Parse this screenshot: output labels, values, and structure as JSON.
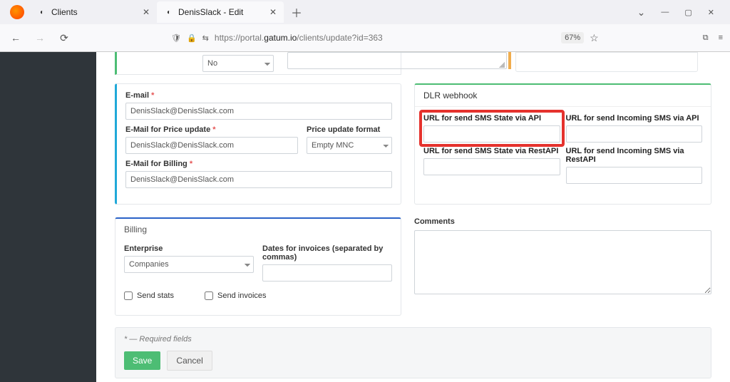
{
  "browser": {
    "tabs": [
      {
        "title": "Clients",
        "favicon": "◐"
      },
      {
        "title": "DenisSlack - Edit",
        "favicon": "◐",
        "active": true
      }
    ],
    "url_prefix": "https://portal.",
    "url_domain": "gatum.io",
    "url_path": "/clients/update?id=363",
    "zoom": "67%"
  },
  "topcard": {
    "select_value": "No"
  },
  "email_block": {
    "email_label": "E-mail",
    "email_value": "DenisSlack@DenisSlack.com",
    "price_label": "E-Mail for Price update",
    "price_value": "DenisSlack@DenisSlack.com",
    "format_label": "Price update format",
    "format_value": "Empty MNC",
    "billing_label": "E-Mail for Billing",
    "billing_value": "DenisSlack@DenisSlack.com"
  },
  "dlr": {
    "title": "DLR webhook",
    "f1": "URL for send SMS State via API",
    "f2": "URL for send Incoming SMS via API",
    "f3": "URL for send SMS State via RestAPI",
    "f4": "URL for send Incoming SMS via RestAPI"
  },
  "billing": {
    "title": "Billing",
    "enterprise_label": "Enterprise",
    "enterprise_value": "Companies",
    "dates_label": "Dates for invoices (separated by commas)",
    "send_stats": "Send stats",
    "send_invoices": "Send invoices"
  },
  "comments": {
    "label": "Comments"
  },
  "footer": {
    "note": "* — Required fields",
    "save": "Save",
    "cancel": "Cancel"
  }
}
